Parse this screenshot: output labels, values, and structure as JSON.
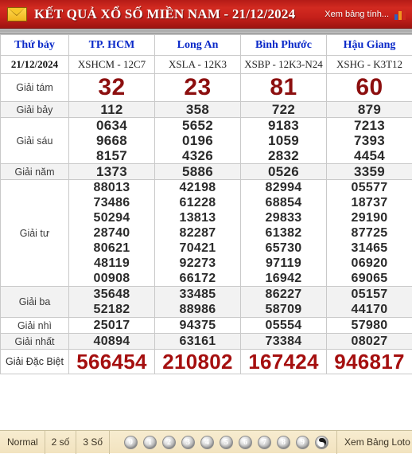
{
  "header": {
    "envelope_icon": "envelope-icon",
    "title": "KẾT QUẢ XỔ SỐ MIỀN NAM - 21/12/2024",
    "link_label": "Xem bảng tính...",
    "chart_icon": "bar-chart-icon",
    "accent_color": "#c5201a"
  },
  "table": {
    "day_label": "Thứ bảy",
    "date": "21/12/2024",
    "provinces": [
      {
        "name": "TP. HCM",
        "code": "XSHCM - 12C7"
      },
      {
        "name": "Long An",
        "code": "XSLA - 12K3"
      },
      {
        "name": "Bình Phước",
        "code": "XSBP - 12K3-N24"
      },
      {
        "name": "Hậu Giang",
        "code": "XSHG - K3T12"
      }
    ],
    "rows": [
      {
        "label": "Giải tám",
        "style": "g8",
        "shaded": false,
        "values": [
          [
            "32"
          ],
          [
            "23"
          ],
          [
            "81"
          ],
          [
            "60"
          ]
        ]
      },
      {
        "label": "Giải bảy",
        "style": "normal",
        "shaded": true,
        "values": [
          [
            "112"
          ],
          [
            "358"
          ],
          [
            "722"
          ],
          [
            "879"
          ]
        ]
      },
      {
        "label": "Giải sáu",
        "style": "normal",
        "shaded": false,
        "values": [
          [
            "0634",
            "9668",
            "8157"
          ],
          [
            "5652",
            "0196",
            "4326"
          ],
          [
            "9183",
            "1059",
            "2832"
          ],
          [
            "7213",
            "7393",
            "4454"
          ]
        ]
      },
      {
        "label": "Giải năm",
        "style": "normal",
        "shaded": true,
        "values": [
          [
            "1373"
          ],
          [
            "5886"
          ],
          [
            "0526"
          ],
          [
            "3359"
          ]
        ]
      },
      {
        "label": "Giải tư",
        "style": "normal",
        "shaded": false,
        "values": [
          [
            "88013",
            "73486",
            "50294",
            "28740",
            "80621",
            "48119",
            "00908"
          ],
          [
            "42198",
            "61228",
            "13813",
            "82287",
            "70421",
            "92273",
            "66172"
          ],
          [
            "82994",
            "68854",
            "29833",
            "61382",
            "65730",
            "97119",
            "16942"
          ],
          [
            "05577",
            "18737",
            "29190",
            "87725",
            "31465",
            "06920",
            "69065"
          ]
        ]
      },
      {
        "label": "Giải ba",
        "style": "normal",
        "shaded": true,
        "values": [
          [
            "35648",
            "52182"
          ],
          [
            "33485",
            "88986"
          ],
          [
            "86227",
            "58709"
          ],
          [
            "05157",
            "44170"
          ]
        ]
      },
      {
        "label": "Giải nhì",
        "style": "normal",
        "shaded": false,
        "values": [
          [
            "25017"
          ],
          [
            "94375"
          ],
          [
            "05554"
          ],
          [
            "57980"
          ]
        ]
      },
      {
        "label": "Giải nhất",
        "style": "normal",
        "shaded": true,
        "values": [
          [
            "40894"
          ],
          [
            "63161"
          ],
          [
            "73384"
          ],
          [
            "08027"
          ]
        ]
      },
      {
        "label": "Giải Đặc Biệt",
        "style": "gdb",
        "shaded": false,
        "values": [
          [
            "566454"
          ],
          [
            "210802"
          ],
          [
            "167424"
          ],
          [
            "946817"
          ]
        ]
      }
    ]
  },
  "bottombar": {
    "mode_label": "Normal",
    "two_digit_label": "2 số",
    "three_digit_label": "3 Số",
    "balls": [
      "0",
      "1",
      "2",
      "3",
      "4",
      "5",
      "6",
      "7",
      "8",
      "9"
    ],
    "yinyang_icon": "yin-yang-icon",
    "loto_label": "Xem Bảng Loto"
  }
}
